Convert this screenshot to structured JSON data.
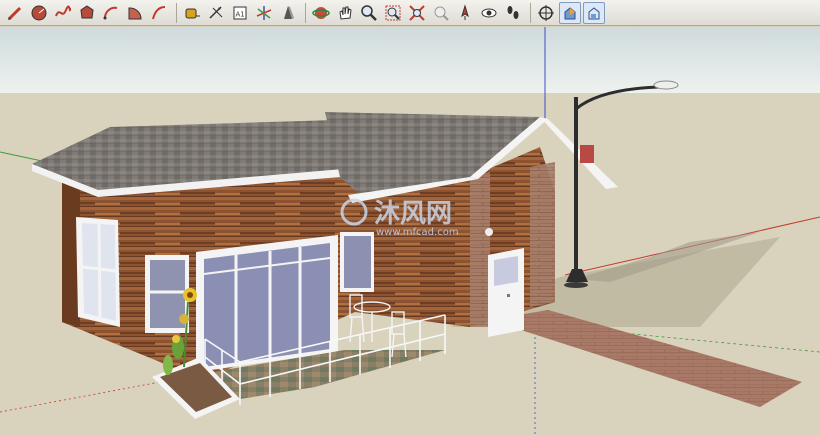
{
  "toolbar": {
    "groups": [
      [
        {
          "name": "pencil-icon",
          "active": false
        },
        {
          "name": "circle-tool-icon",
          "active": false
        },
        {
          "name": "freehand-icon",
          "active": false
        },
        {
          "name": "polygon-icon",
          "active": false
        },
        {
          "name": "arc-icon",
          "active": false
        },
        {
          "name": "pie-icon",
          "active": false
        },
        {
          "name": "curve-icon",
          "active": false
        }
      ],
      [
        {
          "name": "tape-measure-icon",
          "active": false
        },
        {
          "name": "dimension-icon",
          "active": false
        },
        {
          "name": "text-label-icon",
          "active": false
        },
        {
          "name": "axes-icon",
          "active": false
        },
        {
          "name": "3d-text-icon",
          "active": false
        }
      ],
      [
        {
          "name": "orbit-icon",
          "active": false
        },
        {
          "name": "pan-hand-icon",
          "active": false
        },
        {
          "name": "zoom-icon",
          "active": false
        },
        {
          "name": "zoom-window-icon",
          "active": false
        },
        {
          "name": "zoom-extents-icon",
          "active": false
        },
        {
          "name": "previous-view-icon",
          "active": false
        },
        {
          "name": "position-camera-icon",
          "active": false
        },
        {
          "name": "look-around-icon",
          "active": false
        },
        {
          "name": "walk-icon",
          "active": false
        }
      ],
      [
        {
          "name": "section-plane-icon",
          "active": false
        },
        {
          "name": "display-section-planes-icon",
          "active": true
        },
        {
          "name": "display-section-cuts-icon",
          "active": true
        }
      ]
    ],
    "text_label_glyph": "A1"
  },
  "watermark": {
    "cn": "沐风网",
    "url": "www.mfcad.com"
  },
  "colors": {
    "sky": "#dfe7e8",
    "ground": "#d9d3bd",
    "roof": "#7c7874",
    "wall": "#8a5230",
    "axis_red": "#c43a2f",
    "axis_green": "#3f9a3f",
    "axis_blue": "#3a4fc4"
  }
}
